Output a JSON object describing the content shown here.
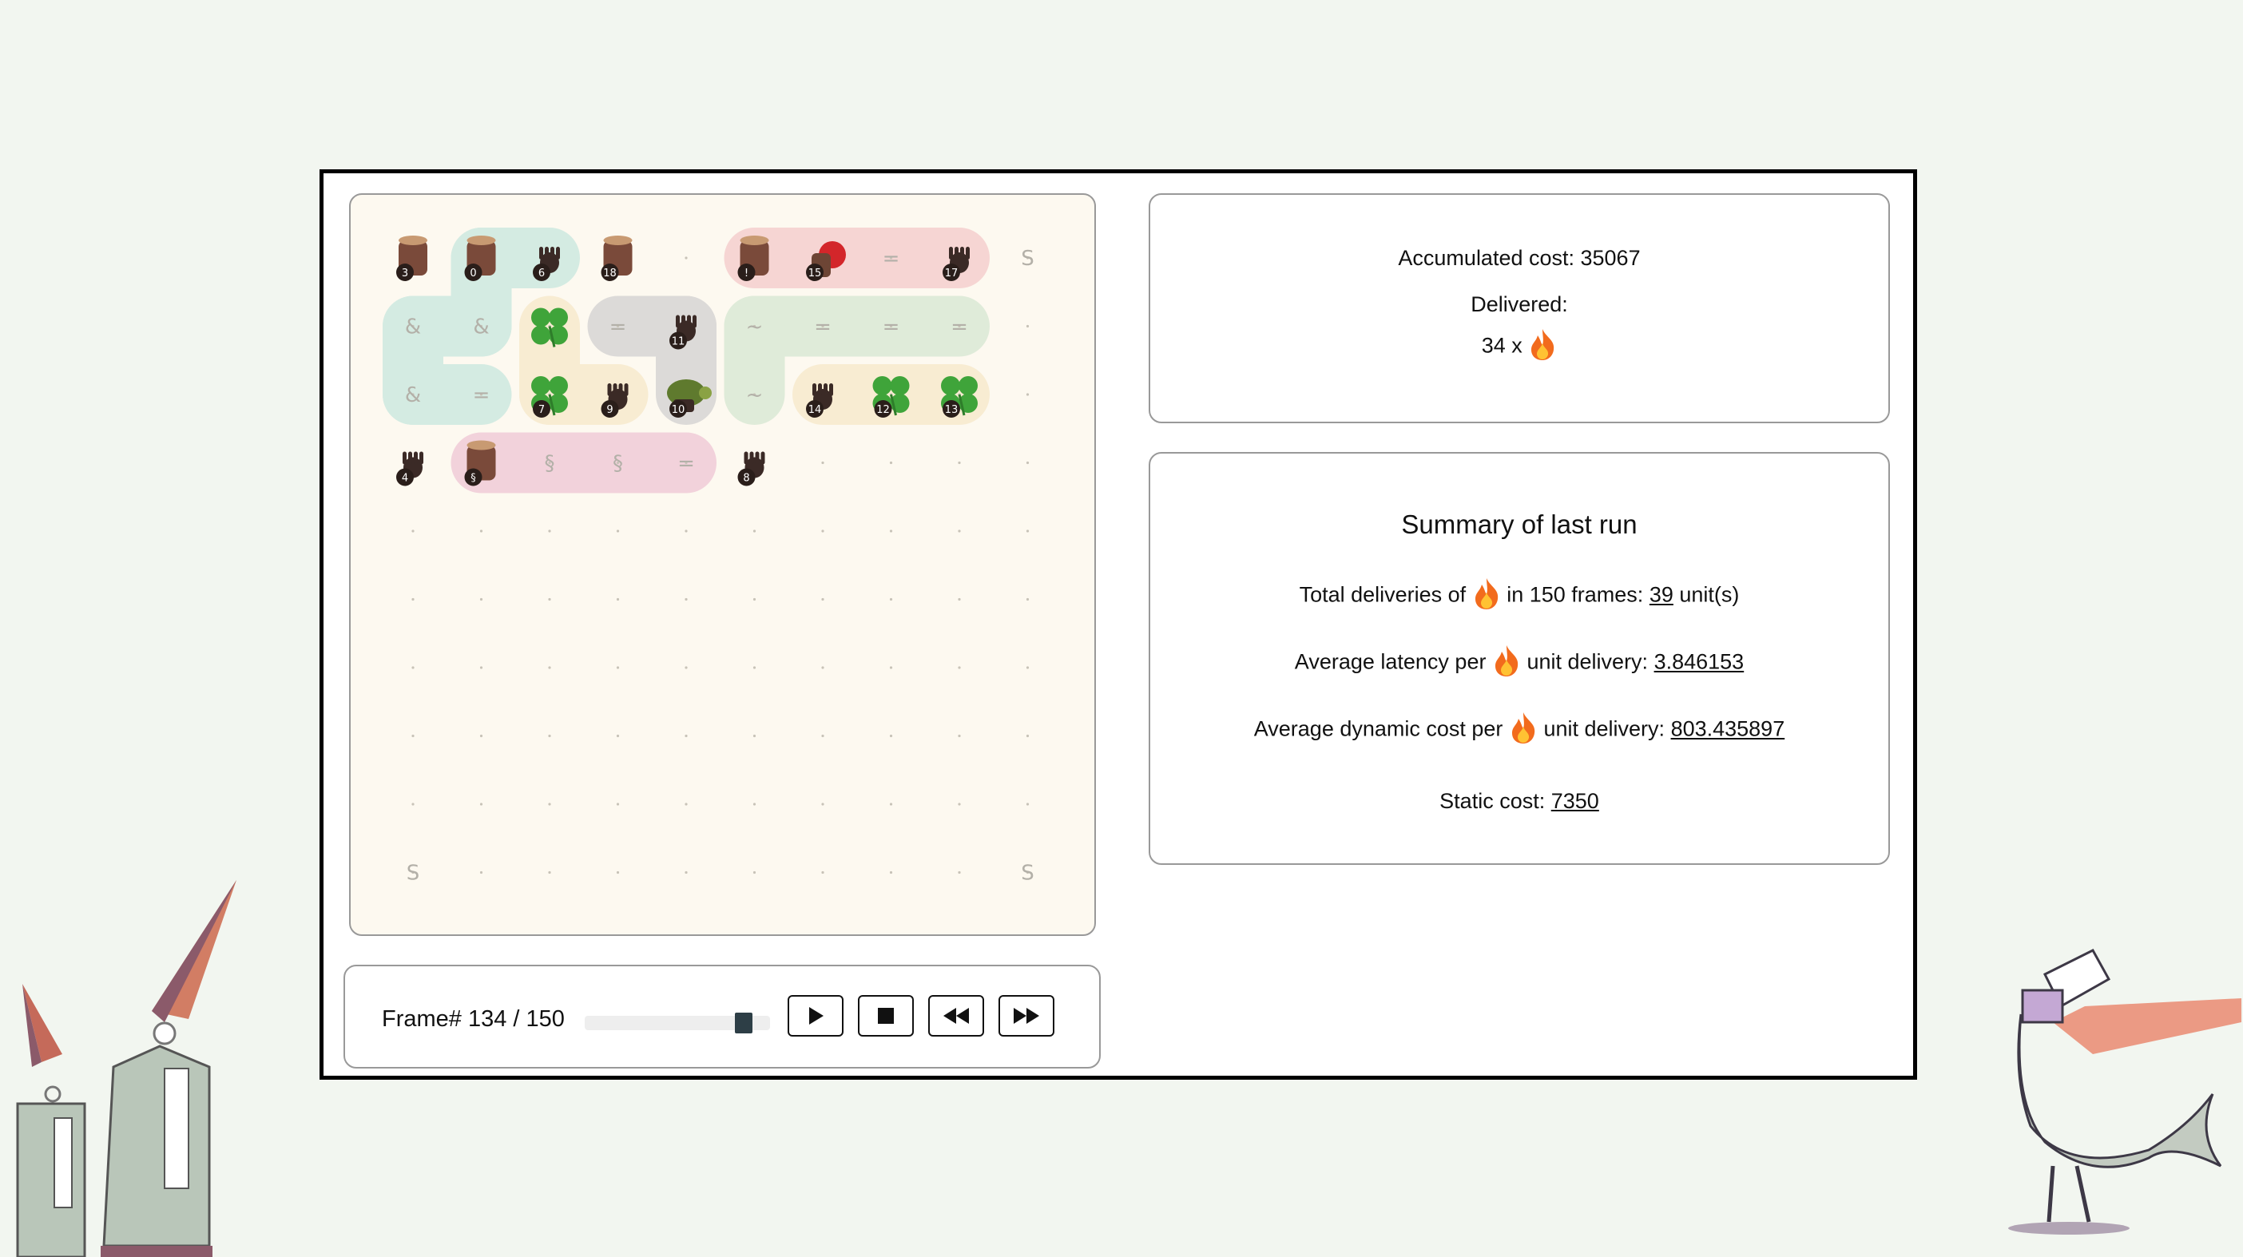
{
  "stats": {
    "accumulated_label": "Accumulated cost: 35067",
    "delivered_label": "Delivered:",
    "delivered_count": "34 x"
  },
  "summary": {
    "title": "Summary of last run",
    "total_prefix": "Total deliveries of",
    "total_mid": "in 150 frames:",
    "total_value": "39",
    "total_suffix": "unit(s)",
    "latency_prefix": "Average latency per",
    "latency_mid": "unit delivery:",
    "latency_value": "3.846153",
    "dyn_prefix": "Average dynamic cost per",
    "dyn_mid": "unit delivery:",
    "dyn_value": "803.435897",
    "static_prefix": "Static cost:",
    "static_value": "7350"
  },
  "controls": {
    "frame_label": "Frame# 134 / 150",
    "frame_current": 134,
    "frame_total": 150,
    "buttons": [
      "play-icon",
      "stop-icon",
      "rewind-icon",
      "fast-forward-icon"
    ]
  },
  "board": {
    "cell_texts": [
      {
        "row": 0,
        "col": 2,
        "text": "="
      },
      {
        "row": 0,
        "col": 7,
        "text": "="
      },
      {
        "row": 0,
        "col": 9,
        "text": "S"
      },
      {
        "row": 1,
        "col": 0,
        "text": "&"
      },
      {
        "row": 1,
        "col": 1,
        "text": "&"
      },
      {
        "row": 1,
        "col": 3,
        "text": "="
      },
      {
        "row": 1,
        "col": 4,
        "text": "="
      },
      {
        "row": 1,
        "col": 5,
        "text": "~"
      },
      {
        "row": 1,
        "col": 6,
        "text": "="
      },
      {
        "row": 1,
        "col": 7,
        "text": "="
      },
      {
        "row": 1,
        "col": 8,
        "text": "="
      },
      {
        "row": 2,
        "col": 0,
        "text": "&"
      },
      {
        "row": 2,
        "col": 1,
        "text": "="
      },
      {
        "row": 2,
        "col": 3,
        "text": "="
      },
      {
        "row": 2,
        "col": 5,
        "text": "~"
      },
      {
        "row": 2,
        "col": 6,
        "text": "="
      },
      {
        "row": 3,
        "col": 2,
        "text": "§"
      },
      {
        "row": 3,
        "col": 3,
        "text": "§"
      },
      {
        "row": 3,
        "col": 4,
        "text": "="
      },
      {
        "row": 9,
        "col": 0,
        "text": "S"
      },
      {
        "row": 9,
        "col": 9,
        "text": "S"
      }
    ],
    "units": [
      {
        "row": 0,
        "col": 0,
        "kind": "stump",
        "num": "3"
      },
      {
        "row": 0,
        "col": 1,
        "kind": "stump",
        "num": "0"
      },
      {
        "row": 0,
        "col": 2,
        "kind": "hand",
        "num": "6"
      },
      {
        "row": 0,
        "col": 3,
        "kind": "stump",
        "num": "18"
      },
      {
        "row": 0,
        "col": 5,
        "kind": "stump",
        "num": "!"
      },
      {
        "row": 0,
        "col": 6,
        "kind": "rose",
        "num": "15"
      },
      {
        "row": 0,
        "col": 8,
        "kind": "hand",
        "num": "17"
      },
      {
        "row": 1,
        "col": 2,
        "kind": "clover",
        "num": ""
      },
      {
        "row": 1,
        "col": 4,
        "kind": "hand",
        "num": "11"
      },
      {
        "row": 2,
        "col": 2,
        "kind": "clover",
        "num": "7"
      },
      {
        "row": 2,
        "col": 3,
        "kind": "hand",
        "num": "9"
      },
      {
        "row": 2,
        "col": 4,
        "kind": "turtle",
        "num": "10"
      },
      {
        "row": 2,
        "col": 6,
        "kind": "hand",
        "num": "14"
      },
      {
        "row": 2,
        "col": 7,
        "kind": "clover",
        "num": "12"
      },
      {
        "row": 2,
        "col": 8,
        "kind": "clover",
        "num": "13"
      },
      {
        "row": 3,
        "col": 0,
        "kind": "hand",
        "num": "4"
      },
      {
        "row": 3,
        "col": 1,
        "kind": "stump",
        "num": "§"
      },
      {
        "row": 3,
        "col": 5,
        "kind": "hand",
        "num": "8"
      }
    ]
  },
  "colors": {
    "fire": "#f26b1d",
    "slider_thumb": "#2d3e46",
    "board_bg": "#fdf9f0",
    "teal_path": "#d4ebe2",
    "pink_path": "#f6d5d3",
    "gray_path": "#dcdad8",
    "green_path": "#dfebd9",
    "yellow_path": "#f8ecd2",
    "rose_path": "#f2d2db"
  }
}
